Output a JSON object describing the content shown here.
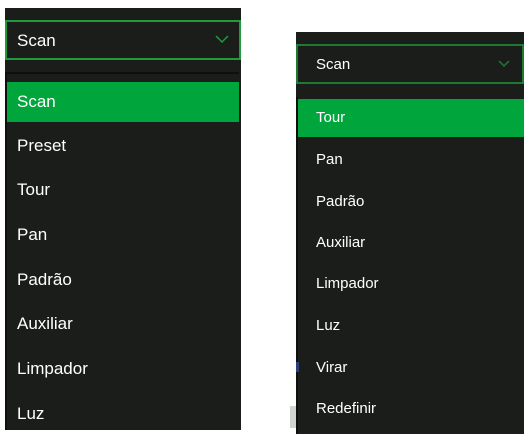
{
  "left_dropdown": {
    "selected_value": "Scan",
    "options": [
      "Scan",
      "Preset",
      "Tour",
      "Pan",
      "Padrão",
      "Auxiliar",
      "Limpador",
      "Luz"
    ],
    "highlighted_option": "Scan",
    "accent_color": "#00a63c",
    "chevron_icon": "chevron-down-icon"
  },
  "right_dropdown": {
    "selected_value": "Scan",
    "options": [
      "Tour",
      "Pan",
      "Padrão",
      "Auxiliar",
      "Limpador",
      "Luz",
      "Virar",
      "Redefinir"
    ],
    "highlighted_option": "Tour",
    "accent_color": "#00a63c",
    "chevron_icon": "chevron-down-icon"
  }
}
